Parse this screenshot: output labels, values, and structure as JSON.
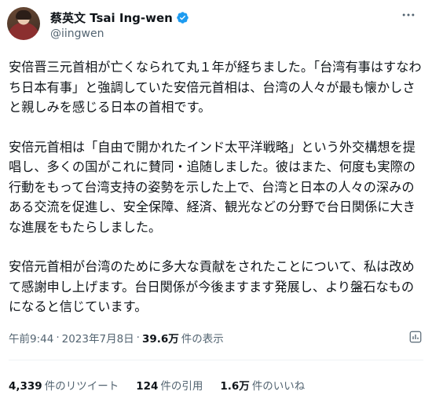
{
  "author": {
    "display_name": "蔡英文 Tsai Ing-wen",
    "handle": "@iingwen",
    "verified": true,
    "verified_color": "#1d9bf0"
  },
  "tweet": {
    "paragraphs": [
      "安倍晋三元首相が亡くなられて丸１年が経ちました。「台湾有事はすなわち日本有事」と強調していた安倍元首相は、台湾の人々が最も懐かしさと親しみを感じる日本の首相です。",
      "安倍元首相は「自由で開かれたインド太平洋戦略」という外交構想を提唱し、多くの国がこれに賛同・追随しました。彼はまた、何度も実際の行動をもって台湾支持の姿勢を示した上で、台湾と日本の人々の深みのある交流を促進し、安全保障、経済、観光などの分野で台日関係に大きな進展をもたらしました。",
      "安倍元首相が台湾のために多大な貢献をされたことについて、私は改めて感謝申し上げます。台日関係が今後ますます発展し、より盤石なものになると信じています。"
    ]
  },
  "meta": {
    "time": "午前9:44",
    "dot1": "·",
    "date": "2023年7月8日",
    "dot2": "·",
    "views_count": "39.6万",
    "views_label": "件の表示"
  },
  "stats": {
    "retweets_count": "4,339",
    "retweets_label": "件のリツイート",
    "quotes_count": "124",
    "quotes_label": "件の引用",
    "likes_count": "1.6万",
    "likes_label": "件のいいね"
  },
  "icons": {
    "more": "more-icon",
    "analytics": "analytics-icon",
    "verified": "verified-badge-icon"
  }
}
